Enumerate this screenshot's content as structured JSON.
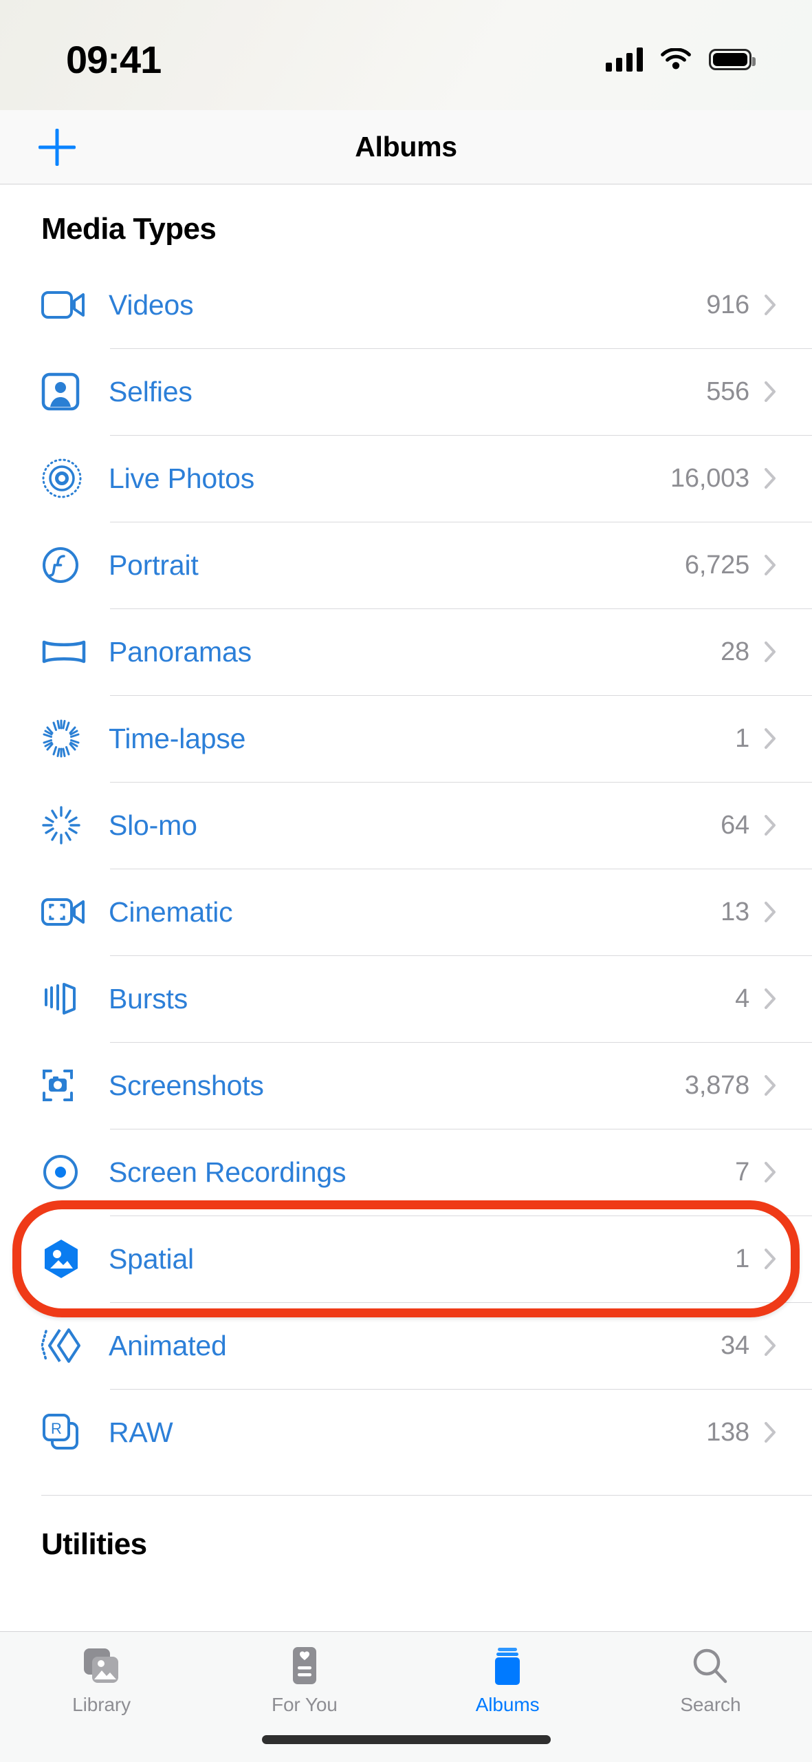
{
  "status_bar": {
    "time": "09:41",
    "cellular_icon": "signal-bars-icon",
    "wifi_icon": "wifi-icon",
    "battery_icon": "battery-full-icon"
  },
  "nav_bar": {
    "add_icon": "plus-icon",
    "title": "Albums"
  },
  "sections": [
    {
      "title": "Media Types"
    },
    {
      "title": "Utilities"
    }
  ],
  "media_types": [
    {
      "label": "Videos",
      "count": "916",
      "icon": "video-camera-icon"
    },
    {
      "label": "Selfies",
      "count": "556",
      "icon": "selfie-person-icon"
    },
    {
      "label": "Live Photos",
      "count": "16,003",
      "icon": "live-photo-icon"
    },
    {
      "label": "Portrait",
      "count": "6,725",
      "icon": "portrait-aperture-icon"
    },
    {
      "label": "Panoramas",
      "count": "28",
      "icon": "panorama-icon"
    },
    {
      "label": "Time-lapse",
      "count": "1",
      "icon": "timelapse-icon"
    },
    {
      "label": "Slo-mo",
      "count": "64",
      "icon": "slomo-icon"
    },
    {
      "label": "Cinematic",
      "count": "13",
      "icon": "cinematic-video-icon"
    },
    {
      "label": "Bursts",
      "count": "4",
      "icon": "bursts-stack-icon"
    },
    {
      "label": "Screenshots",
      "count": "3,878",
      "icon": "screenshot-camera-icon"
    },
    {
      "label": "Screen Recordings",
      "count": "7",
      "icon": "screen-record-icon"
    },
    {
      "label": "Spatial",
      "count": "1",
      "icon": "spatial-hexagon-icon",
      "highlighted": true
    },
    {
      "label": "Animated",
      "count": "34",
      "icon": "animated-diamond-icon"
    },
    {
      "label": "RAW",
      "count": "138",
      "icon": "raw-squares-icon"
    }
  ],
  "tab_bar": {
    "tabs": [
      {
        "label": "Library",
        "icon": "photo-stack-icon",
        "active": false
      },
      {
        "label": "For You",
        "icon": "for-you-card-icon",
        "active": false
      },
      {
        "label": "Albums",
        "icon": "albums-books-icon",
        "active": true
      },
      {
        "label": "Search",
        "icon": "search-icon",
        "active": false
      }
    ]
  },
  "colors": {
    "accent_blue": "#2c7fd8",
    "tab_active_blue": "#007aff",
    "count_gray": "#8e8e93",
    "highlight_red": "#ef3a17"
  }
}
